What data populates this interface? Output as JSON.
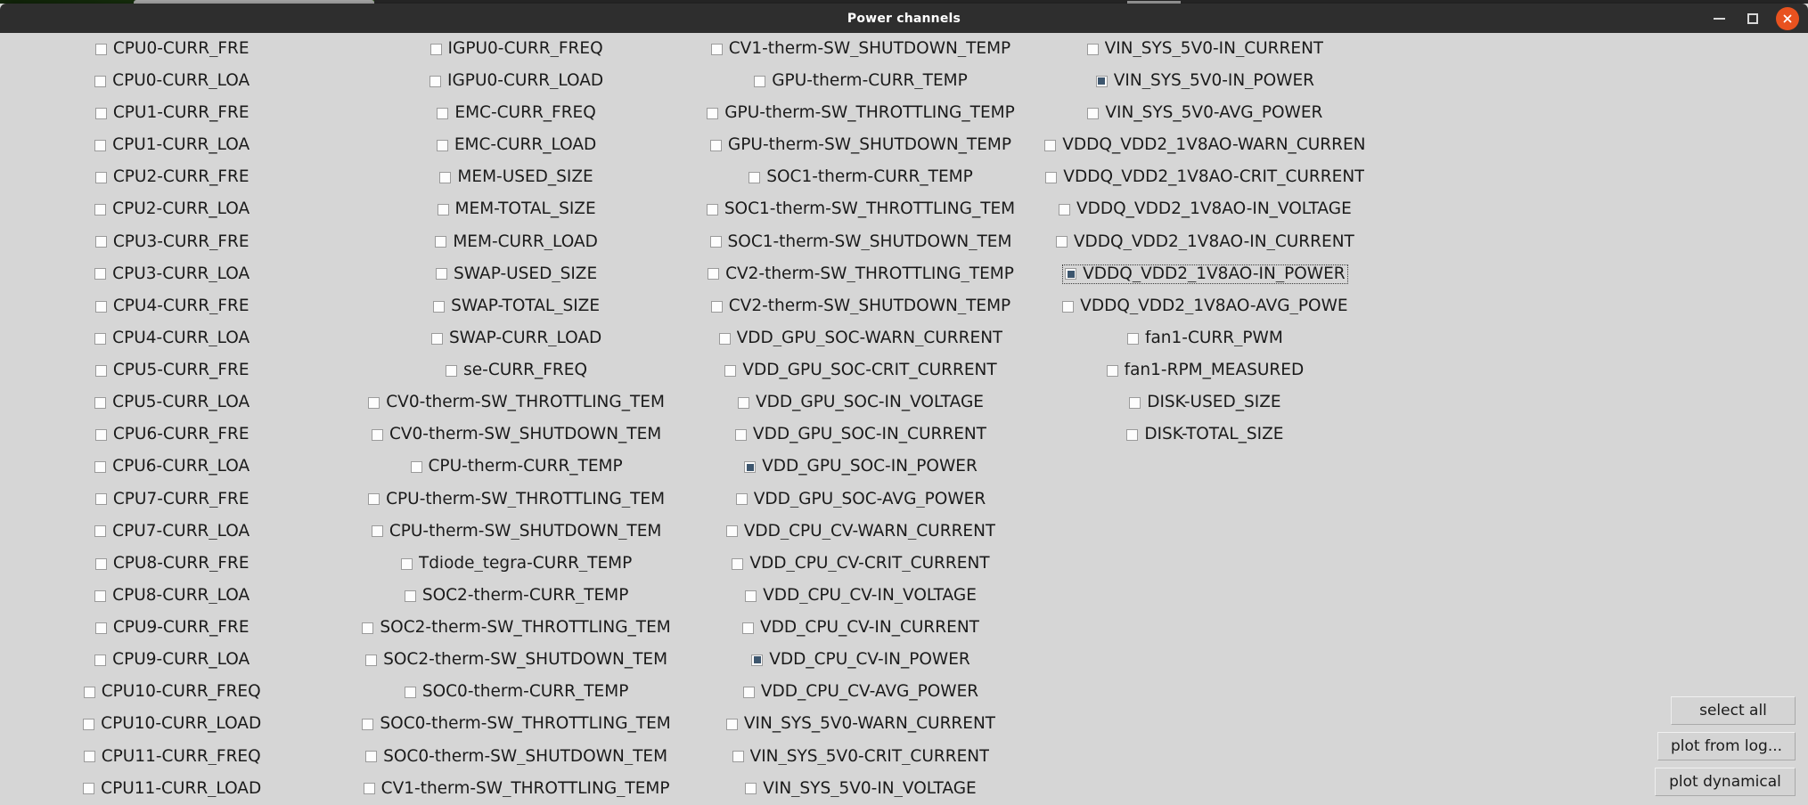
{
  "window": {
    "title": "Power channels",
    "controls": {
      "minimize": "minimize-button",
      "maximize": "maximize-button",
      "close": "close-button"
    },
    "accent_close_color": "#e8521f",
    "titlebar_color": "#2e2e2e",
    "body_color": "#d6d6d6",
    "checked_mark_color": "#3d566e"
  },
  "channels": [
    {
      "label": "CPU0-CURR_FRE",
      "checked": false
    },
    {
      "label": "CPU0-CURR_LOA",
      "checked": false
    },
    {
      "label": "CPU1-CURR_FRE",
      "checked": false
    },
    {
      "label": "CPU1-CURR_LOA",
      "checked": false
    },
    {
      "label": "CPU2-CURR_FRE",
      "checked": false
    },
    {
      "label": "CPU2-CURR_LOA",
      "checked": false
    },
    {
      "label": "CPU3-CURR_FRE",
      "checked": false
    },
    {
      "label": "CPU3-CURR_LOA",
      "checked": false
    },
    {
      "label": "CPU4-CURR_FRE",
      "checked": false
    },
    {
      "label": "CPU4-CURR_LOA",
      "checked": false
    },
    {
      "label": "CPU5-CURR_FRE",
      "checked": false
    },
    {
      "label": "CPU5-CURR_LOA",
      "checked": false
    },
    {
      "label": "CPU6-CURR_FRE",
      "checked": false
    },
    {
      "label": "CPU6-CURR_LOA",
      "checked": false
    },
    {
      "label": "CPU7-CURR_FRE",
      "checked": false
    },
    {
      "label": "CPU7-CURR_LOA",
      "checked": false
    },
    {
      "label": "CPU8-CURR_FRE",
      "checked": false
    },
    {
      "label": "CPU8-CURR_LOA",
      "checked": false
    },
    {
      "label": "CPU9-CURR_FRE",
      "checked": false
    },
    {
      "label": "CPU9-CURR_LOA",
      "checked": false
    },
    {
      "label": "CPU10-CURR_FREQ",
      "checked": false
    },
    {
      "label": "CPU10-CURR_LOAD",
      "checked": false
    },
    {
      "label": "CPU11-CURR_FREQ",
      "checked": false
    },
    {
      "label": "CPU11-CURR_LOAD",
      "checked": false
    },
    {
      "label": "IGPU0-CURR_FREQ",
      "checked": false
    },
    {
      "label": "IGPU0-CURR_LOAD",
      "checked": false
    },
    {
      "label": "EMC-CURR_FREQ",
      "checked": false
    },
    {
      "label": "EMC-CURR_LOAD",
      "checked": false
    },
    {
      "label": "MEM-USED_SIZE",
      "checked": false
    },
    {
      "label": "MEM-TOTAL_SIZE",
      "checked": false
    },
    {
      "label": "MEM-CURR_LOAD",
      "checked": false
    },
    {
      "label": "SWAP-USED_SIZE",
      "checked": false
    },
    {
      "label": "SWAP-TOTAL_SIZE",
      "checked": false
    },
    {
      "label": "SWAP-CURR_LOAD",
      "checked": false
    },
    {
      "label": "se-CURR_FREQ",
      "checked": false
    },
    {
      "label": "CV0-therm-SW_THROTTLING_TEM",
      "checked": false
    },
    {
      "label": "CV0-therm-SW_SHUTDOWN_TEM",
      "checked": false
    },
    {
      "label": "CPU-therm-CURR_TEMP",
      "checked": false
    },
    {
      "label": "CPU-therm-SW_THROTTLING_TEM",
      "checked": false
    },
    {
      "label": "CPU-therm-SW_SHUTDOWN_TEM",
      "checked": false
    },
    {
      "label": "Tdiode_tegra-CURR_TEMP",
      "checked": false
    },
    {
      "label": "SOC2-therm-CURR_TEMP",
      "checked": false
    },
    {
      "label": "SOC2-therm-SW_THROTTLING_TEM",
      "checked": false
    },
    {
      "label": "SOC2-therm-SW_SHUTDOWN_TEM",
      "checked": false
    },
    {
      "label": "SOC0-therm-CURR_TEMP",
      "checked": false
    },
    {
      "label": "SOC0-therm-SW_THROTTLING_TEM",
      "checked": false
    },
    {
      "label": "SOC0-therm-SW_SHUTDOWN_TEM",
      "checked": false
    },
    {
      "label": "CV1-therm-SW_THROTTLING_TEMP",
      "checked": false
    },
    {
      "label": "CV1-therm-SW_SHUTDOWN_TEMP",
      "checked": false
    },
    {
      "label": "GPU-therm-CURR_TEMP",
      "checked": false
    },
    {
      "label": "GPU-therm-SW_THROTTLING_TEMP",
      "checked": false
    },
    {
      "label": "GPU-therm-SW_SHUTDOWN_TEMP",
      "checked": false
    },
    {
      "label": "SOC1-therm-CURR_TEMP",
      "checked": false
    },
    {
      "label": "SOC1-therm-SW_THROTTLING_TEM",
      "checked": false
    },
    {
      "label": "SOC1-therm-SW_SHUTDOWN_TEM",
      "checked": false
    },
    {
      "label": "CV2-therm-SW_THROTTLING_TEMP",
      "checked": false
    },
    {
      "label": "CV2-therm-SW_SHUTDOWN_TEMP",
      "checked": false
    },
    {
      "label": "VDD_GPU_SOC-WARN_CURRENT",
      "checked": false
    },
    {
      "label": "VDD_GPU_SOC-CRIT_CURRENT",
      "checked": false
    },
    {
      "label": "VDD_GPU_SOC-IN_VOLTAGE",
      "checked": false
    },
    {
      "label": "VDD_GPU_SOC-IN_CURRENT",
      "checked": false
    },
    {
      "label": "VDD_GPU_SOC-IN_POWER",
      "checked": true
    },
    {
      "label": "VDD_GPU_SOC-AVG_POWER",
      "checked": false
    },
    {
      "label": "VDD_CPU_CV-WARN_CURRENT",
      "checked": false
    },
    {
      "label": "VDD_CPU_CV-CRIT_CURRENT",
      "checked": false
    },
    {
      "label": "VDD_CPU_CV-IN_VOLTAGE",
      "checked": false
    },
    {
      "label": "VDD_CPU_CV-IN_CURRENT",
      "checked": false
    },
    {
      "label": "VDD_CPU_CV-IN_POWER",
      "checked": true
    },
    {
      "label": "VDD_CPU_CV-AVG_POWER",
      "checked": false
    },
    {
      "label": "VIN_SYS_5V0-WARN_CURRENT",
      "checked": false
    },
    {
      "label": "VIN_SYS_5V0-CRIT_CURRENT",
      "checked": false
    },
    {
      "label": "VIN_SYS_5V0-IN_VOLTAGE",
      "checked": false
    },
    {
      "label": "VIN_SYS_5V0-IN_CURRENT",
      "checked": false
    },
    {
      "label": "VIN_SYS_5V0-IN_POWER",
      "checked": true
    },
    {
      "label": "VIN_SYS_5V0-AVG_POWER",
      "checked": false
    },
    {
      "label": "VDDQ_VDD2_1V8AO-WARN_CURREN",
      "checked": false
    },
    {
      "label": "VDDQ_VDD2_1V8AO-CRIT_CURRENT",
      "checked": false
    },
    {
      "label": "VDDQ_VDD2_1V8AO-IN_VOLTAGE",
      "checked": false
    },
    {
      "label": "VDDQ_VDD2_1V8AO-IN_CURRENT",
      "checked": false
    },
    {
      "label": "VDDQ_VDD2_1V8AO-IN_POWER",
      "checked": true,
      "focused": true
    },
    {
      "label": "VDDQ_VDD2_1V8AO-AVG_POWE",
      "checked": false
    },
    {
      "label": "fan1-CURR_PWM",
      "checked": false
    },
    {
      "label": "fan1-RPM_MEASURED",
      "checked": false
    },
    {
      "label": "DISK-USED_SIZE",
      "checked": false
    },
    {
      "label": "DISK-TOTAL_SIZE",
      "checked": false
    }
  ],
  "buttons": [
    {
      "label": "select all",
      "name": "select-all-button"
    },
    {
      "label": "plot from log...",
      "name": "plot-from-log-button"
    },
    {
      "label": "plot dynamical",
      "name": "plot-dynamical-button"
    }
  ]
}
